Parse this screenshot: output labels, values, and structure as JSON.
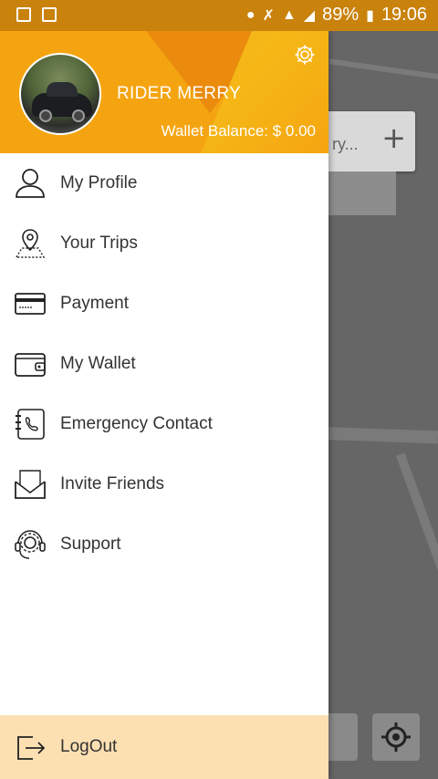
{
  "status_bar": {
    "battery": "89%",
    "time": "19:06",
    "icons": [
      "image-icon",
      "sync-icon",
      "location-icon",
      "mute-icon",
      "wifi-icon",
      "signal-icon",
      "battery-icon"
    ]
  },
  "drawer": {
    "header": {
      "rider_name": "RIDER MERRY",
      "wallet_balance": "Wallet Balance: $ 0.00"
    },
    "menu": [
      {
        "label": "My Profile",
        "icon": "person-icon"
      },
      {
        "label": "Your Trips",
        "icon": "map-pin-icon"
      },
      {
        "label": "Payment",
        "icon": "card-icon"
      },
      {
        "label": "My Wallet",
        "icon": "wallet-icon"
      },
      {
        "label": "Emergency Contact",
        "icon": "contact-book-icon"
      },
      {
        "label": "Invite Friends",
        "icon": "envelope-icon"
      },
      {
        "label": "Support",
        "icon": "headset-icon"
      }
    ],
    "logout_label": "LogOut"
  },
  "map": {
    "search_hint": "ry..."
  },
  "colors": {
    "status_bar": "#c9820c",
    "header_orange": "#f5a411",
    "logout_bg": "#fde0b2"
  }
}
